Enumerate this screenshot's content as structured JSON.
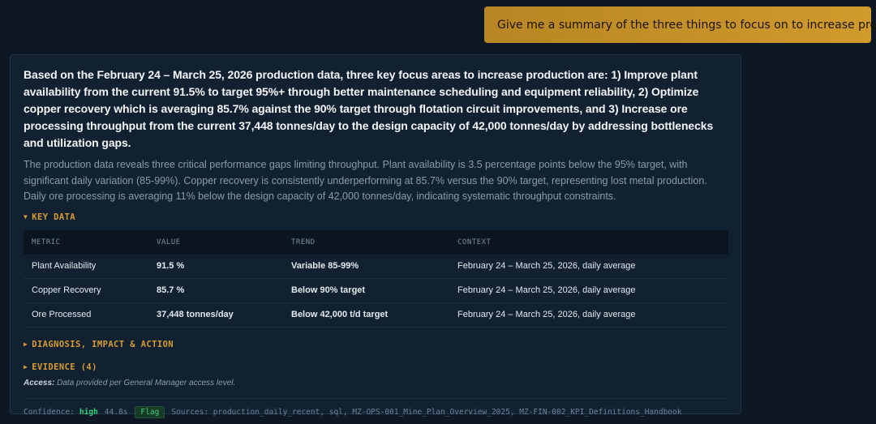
{
  "user_message": "Give me a summary of the three things to focus on to increase production",
  "response": {
    "headline": "Based on the February 24 – March 25, 2026 production data, three key focus areas to increase production are: 1) Improve plant availability from the current 91.5% to target 95%+ through better maintenance scheduling and equipment reliability, 2) Optimize copper recovery which is averaging 85.7% against the 90% target through flotation circuit improvements, and 3) Increase ore processing throughput from the current 37,448 tonnes/day to the design capacity of 42,000 tonnes/day by addressing bottlenecks and utilization gaps.",
    "description": "The production data reveals three critical performance gaps limiting throughput. Plant availability is 3.5 percentage points below the 95% target, with significant daily variation (85-99%). Copper recovery is consistently underperforming at 85.7% versus the 90% target, representing lost metal production. Daily ore processing is averaging 11% below the design capacity of 42,000 tonnes/day, indicating systematic throughput constraints.",
    "key_data": {
      "label": "KEY DATA",
      "columns": [
        "METRIC",
        "VALUE",
        "TREND",
        "CONTEXT"
      ],
      "rows": [
        {
          "metric": "Plant Availability",
          "value": "91.5 %",
          "trend": "Variable 85-99%",
          "context": "February 24 – March 25, 2026, daily average"
        },
        {
          "metric": "Copper Recovery",
          "value": "85.7 %",
          "trend": "Below 90% target",
          "context": "February 24 – March 25, 2026, daily average"
        },
        {
          "metric": "Ore Processed",
          "value": "37,448 tonnes/day",
          "trend": "Below 42,000 t/d target",
          "context": "February 24 – March 25, 2026, daily average"
        }
      ]
    },
    "diagnosis_label": "DIAGNOSIS, IMPACT & ACTION",
    "evidence_label": "EVIDENCE (4)",
    "access_label": "Access:",
    "access_text": "Data provided per General Manager access level.",
    "footer": {
      "confidence_label": "Confidence:",
      "confidence_value": "high",
      "time": "44.8s",
      "flag_label": "Flag",
      "sources": "Sources: production_daily_recent, sql, MZ-OPS-001_Mine_Plan_Overview_2025, MZ-FIN-002_KPI_Definitions_Handbook"
    }
  },
  "colors": {
    "accent": "#d79b32",
    "confidence_high": "#2fd27a",
    "background": "#0d1824",
    "card": "#112132"
  },
  "icons": {
    "expanded": "triangle-down-icon",
    "collapsed": "triangle-right-icon"
  }
}
